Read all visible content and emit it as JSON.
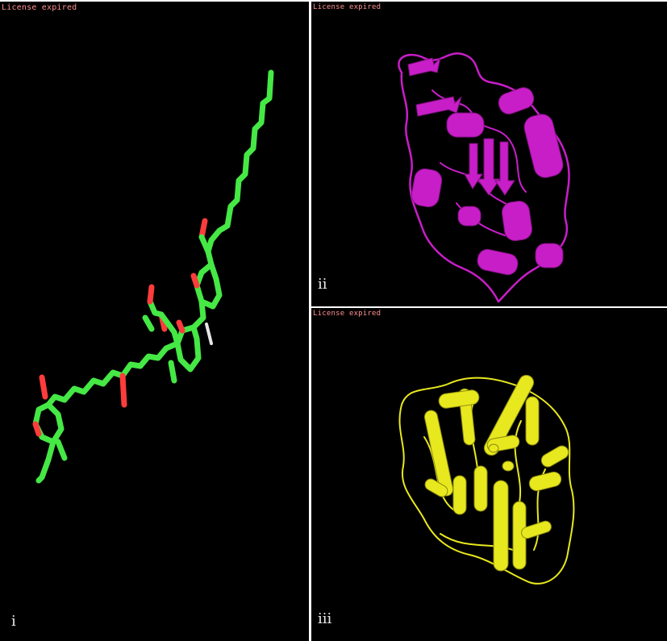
{
  "panels": {
    "i": {
      "label": "i",
      "watermark": "License expired",
      "representation": "ligand stick model"
    },
    "ii": {
      "label": "ii",
      "watermark": "License expired",
      "representation": "protein cartoon ribbon"
    },
    "iii": {
      "label": "iii",
      "watermark": "License expired",
      "representation": "protein cylinder helices"
    }
  },
  "colors": {
    "background": "#000000",
    "carbon": "#45e845",
    "oxygen": "#ff3c3c",
    "hydrogen": "#e6e6e6",
    "protein_ii": "#c81ec8",
    "protein_iii": "#e8e81e",
    "watermark": "#ff8f8f"
  }
}
